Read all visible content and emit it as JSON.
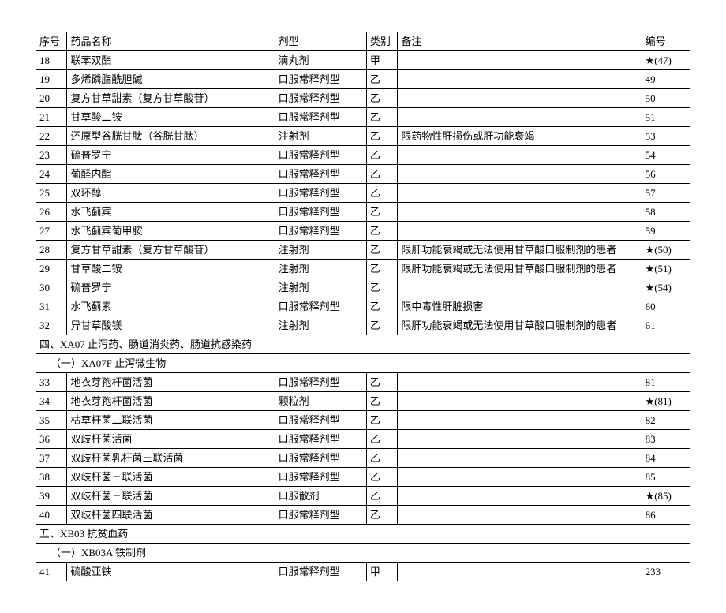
{
  "headers": {
    "seq": "序号",
    "name": "药品名称",
    "form": "剂型",
    "cat": "类别",
    "remark": "备注",
    "code": "编号"
  },
  "rows": [
    {
      "type": "data",
      "seq": "18",
      "name": "联苯双酯",
      "form": "滴丸剂",
      "cat": "甲",
      "remark": "",
      "code": "★(47)"
    },
    {
      "type": "data",
      "seq": "19",
      "name": "多烯磷脂酰胆碱",
      "form": "口服常释剂型",
      "cat": "乙",
      "remark": "",
      "code": "49"
    },
    {
      "type": "data",
      "seq": "20",
      "name": "复方甘草甜素（复方甘草酸苷）",
      "form": "口服常释剂型",
      "cat": "乙",
      "remark": "",
      "code": "50"
    },
    {
      "type": "data",
      "seq": "21",
      "name": "甘草酸二铵",
      "form": "口服常释剂型",
      "cat": "乙",
      "remark": "",
      "code": "51"
    },
    {
      "type": "data",
      "seq": "22",
      "name": "还原型谷胱甘肽（谷胱甘肽）",
      "form": "注射剂",
      "cat": "乙",
      "remark": "限药物性肝损伤或肝功能衰竭",
      "code": "53"
    },
    {
      "type": "data",
      "seq": "23",
      "name": "硫普罗宁",
      "form": "口服常释剂型",
      "cat": "乙",
      "remark": "",
      "code": "54"
    },
    {
      "type": "data",
      "seq": "24",
      "name": "葡醛内酯",
      "form": "口服常释剂型",
      "cat": "乙",
      "remark": "",
      "code": "56"
    },
    {
      "type": "data",
      "seq": "25",
      "name": "双环醇",
      "form": "口服常释剂型",
      "cat": "乙",
      "remark": "",
      "code": "57"
    },
    {
      "type": "data",
      "seq": "26",
      "name": "水飞蓟宾",
      "form": "口服常释剂型",
      "cat": "乙",
      "remark": "",
      "code": "58"
    },
    {
      "type": "data",
      "seq": "27",
      "name": "水飞蓟宾葡甲胺",
      "form": "口服常释剂型",
      "cat": "乙",
      "remark": "",
      "code": "59"
    },
    {
      "type": "data",
      "seq": "28",
      "name": "复方甘草甜素（复方甘草酸苷）",
      "form": "注射剂",
      "cat": "乙",
      "remark": "限肝功能衰竭或无法使用甘草酸口服制剂的患者",
      "code": "★(50)"
    },
    {
      "type": "data",
      "seq": "29",
      "name": "甘草酸二铵",
      "form": "注射剂",
      "cat": "乙",
      "remark": "限肝功能衰竭或无法使用甘草酸口服制剂的患者",
      "code": "★(51)"
    },
    {
      "type": "data",
      "seq": "30",
      "name": "硫普罗宁",
      "form": "注射剂",
      "cat": "乙",
      "remark": "",
      "code": "★(54)"
    },
    {
      "type": "data",
      "seq": "31",
      "name": "水飞蓟素",
      "form": "口服常释剂型",
      "cat": "乙",
      "remark": "限中毒性肝脏损害",
      "code": "60"
    },
    {
      "type": "data",
      "seq": "32",
      "name": "异甘草酸镁",
      "form": "注射剂",
      "cat": "乙",
      "remark": "限肝功能衰竭或无法使用甘草酸口服制剂的患者",
      "code": "61"
    },
    {
      "type": "section",
      "text": "四、XA07 止泻药、肠道消炎药、肠道抗感染药"
    },
    {
      "type": "subsection",
      "text": "（一）XA07F 止泻微生物"
    },
    {
      "type": "data",
      "seq": "33",
      "name": "地衣芽孢杆菌活菌",
      "form": "口服常释剂型",
      "cat": "乙",
      "remark": "",
      "code": "81"
    },
    {
      "type": "data",
      "seq": "34",
      "name": "地衣芽孢杆菌活菌",
      "form": "颗粒剂",
      "cat": "乙",
      "remark": "",
      "code": "★(81)"
    },
    {
      "type": "data",
      "seq": "35",
      "name": "枯草杆菌二联活菌",
      "form": "口服常释剂型",
      "cat": "乙",
      "remark": "",
      "code": "82"
    },
    {
      "type": "data",
      "seq": "36",
      "name": "双歧杆菌活菌",
      "form": "口服常释剂型",
      "cat": "乙",
      "remark": "",
      "code": "83"
    },
    {
      "type": "data",
      "seq": "37",
      "name": "双歧杆菌乳杆菌三联活菌",
      "form": "口服常释剂型",
      "cat": "乙",
      "remark": "",
      "code": "84"
    },
    {
      "type": "data",
      "seq": "38",
      "name": "双歧杆菌三联活菌",
      "form": "口服常释剂型",
      "cat": "乙",
      "remark": "",
      "code": "85"
    },
    {
      "type": "data",
      "seq": "39",
      "name": "双歧杆菌三联活菌",
      "form": "口服散剂",
      "cat": "乙",
      "remark": "",
      "code": "★(85)"
    },
    {
      "type": "data",
      "seq": "40",
      "name": "双歧杆菌四联活菌",
      "form": "口服常释剂型",
      "cat": "乙",
      "remark": "",
      "code": "86"
    },
    {
      "type": "section",
      "text": "五、XB03 抗贫血药"
    },
    {
      "type": "subsection",
      "text": "（一）XB03A 铁制剂"
    },
    {
      "type": "data",
      "seq": "41",
      "name": "硫酸亚铁",
      "form": "口服常释剂型",
      "cat": "甲",
      "remark": "",
      "code": "233"
    }
  ]
}
